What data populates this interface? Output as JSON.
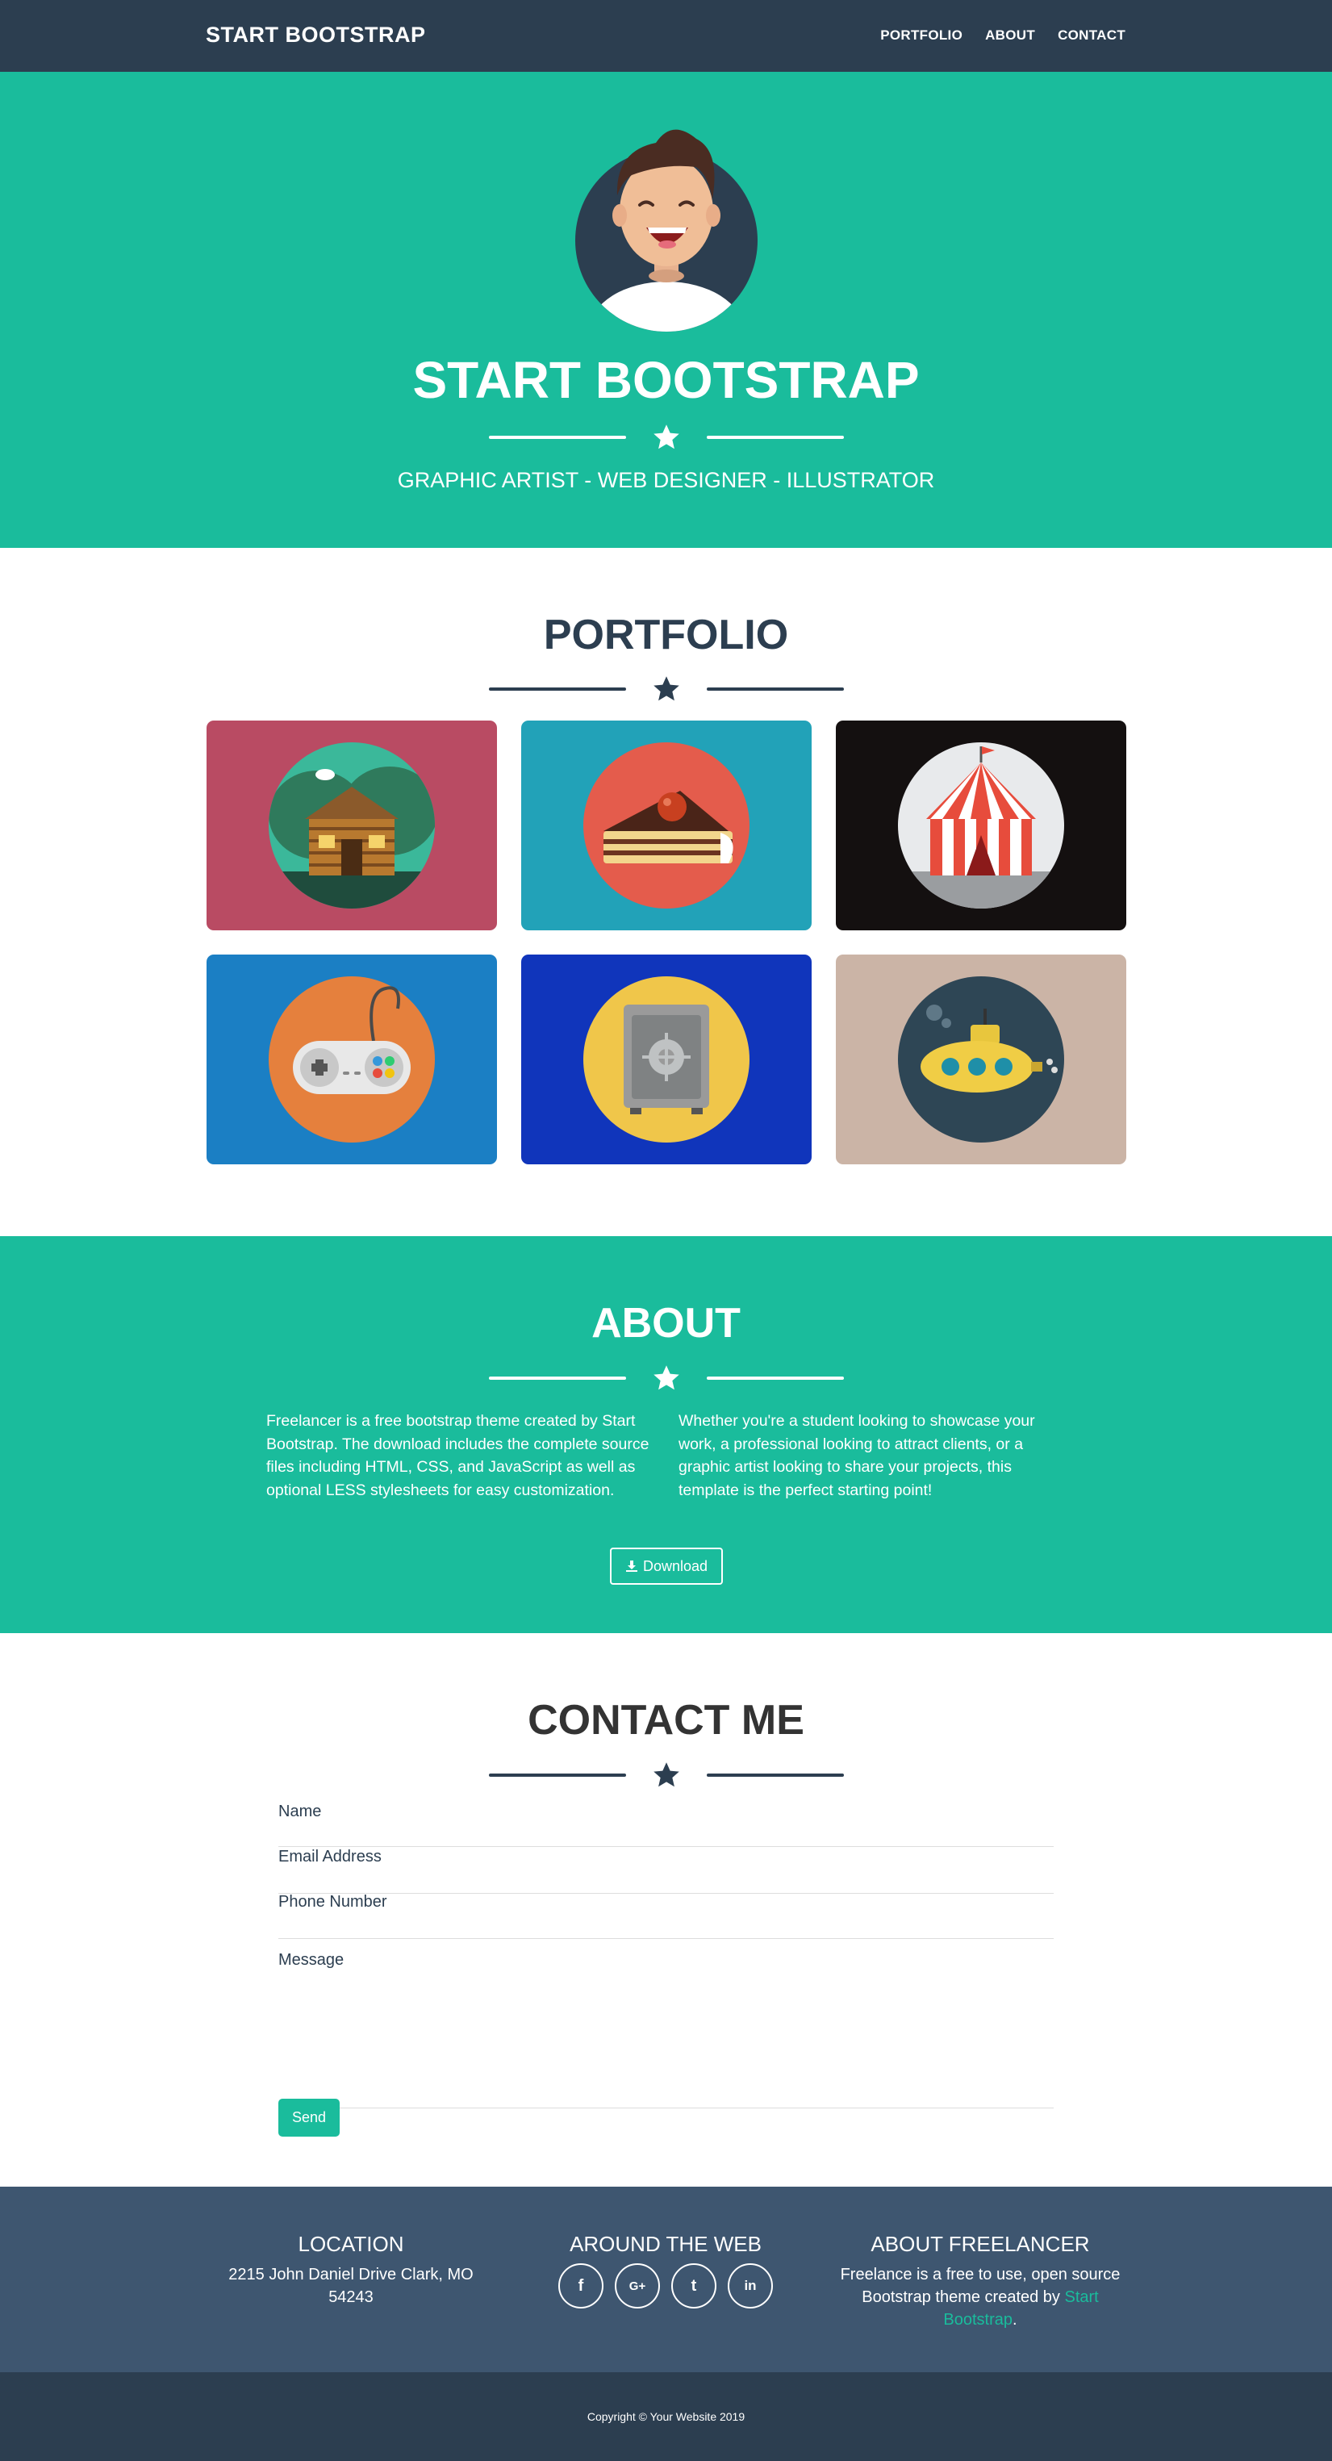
{
  "nav": {
    "brand": "START BOOTSTRAP",
    "links": [
      "PORTFOLIO",
      "ABOUT",
      "CONTACT"
    ]
  },
  "hero": {
    "title": "START BOOTSTRAP",
    "subtitle": "GRAPHIC ARTIST - WEB DESIGNER - ILLUSTRATOR"
  },
  "portfolio": {
    "title": "PORTFOLIO",
    "items": [
      {
        "name": "cabin",
        "bg": "#b94b63"
      },
      {
        "name": "cake",
        "bg": "#22a2b8"
      },
      {
        "name": "circus",
        "bg": "#141010"
      },
      {
        "name": "game",
        "bg": "#1b7fc4"
      },
      {
        "name": "safe",
        "bg": "#1035bb"
      },
      {
        "name": "submarine",
        "bg": "#cbb4a6"
      }
    ]
  },
  "about": {
    "title": "ABOUT",
    "left": "Freelancer is a free bootstrap theme created by Start Bootstrap. The download includes the complete source files including HTML, CSS, and JavaScript as well as optional LESS stylesheets for easy customization.",
    "right": "Whether you're a student looking to showcase your work, a professional looking to attract clients, or a graphic artist looking to share your projects, this template is the perfect starting point!",
    "download_label": "Download"
  },
  "contact": {
    "title": "CONTACT ME",
    "name_placeholder": "Name",
    "email_placeholder": "Email Address",
    "phone_placeholder": "Phone Number",
    "message_placeholder": "Message",
    "send_label": "Send"
  },
  "footer": {
    "location_title": "LOCATION",
    "location_line1": "2215 John Daniel Drive Clark, MO",
    "location_line2": "54243",
    "web_title": "AROUND THE WEB",
    "socials": [
      "f",
      "G+",
      "t",
      "in"
    ],
    "about_title": "ABOUT FREELANCER",
    "about_text": "Freelance is a free to use, open source Bootstrap theme created by",
    "about_link": "Start Bootstrap",
    "about_end": ".",
    "copyright": "Copyright © Your Website 2019"
  },
  "colors": {
    "primary": "#2c3e50",
    "accent": "#1abc9c",
    "footer": "#3e5670"
  }
}
